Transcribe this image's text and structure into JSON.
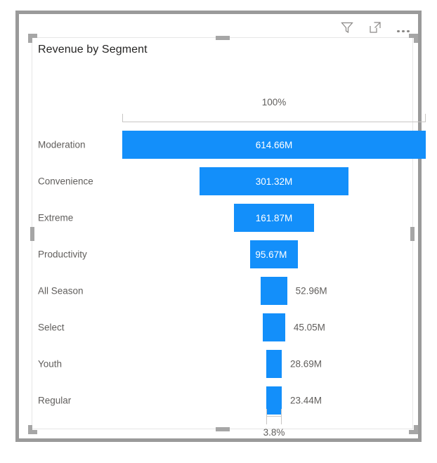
{
  "header": {
    "icons": [
      {
        "name": "filter-icon",
        "label": "Filters"
      },
      {
        "name": "focus-mode-icon",
        "label": "Focus mode"
      },
      {
        "name": "more-options-icon",
        "label": "More options"
      }
    ]
  },
  "visual": {
    "title": "Revenue by Segment",
    "top_axis_label": "100%",
    "bottom_axis_label": "3.8%",
    "accent_color": "#138ffa",
    "label_color": "#605e5c",
    "title_color": "#252423"
  },
  "chart_data": {
    "type": "bar",
    "subtype": "funnel",
    "title": "Revenue by Segment",
    "xlabel": "",
    "ylabel": "",
    "categories": [
      "Moderation",
      "Convenience",
      "Extreme",
      "Productivity",
      "All Season",
      "Select",
      "Youth",
      "Regular"
    ],
    "values": [
      614.66,
      301.32,
      161.87,
      95.67,
      52.96,
      45.05,
      28.69,
      23.44
    ],
    "value_labels": [
      "614.66M",
      "301.32M",
      "161.87M",
      "95.67M",
      "52.96M",
      "45.05M",
      "28.69M",
      "23.44M"
    ],
    "units": "M",
    "first_to_last_percent": "3.8%",
    "highest_percent": "100%",
    "grid": false,
    "legend": "none",
    "rows": [
      {
        "category": "Moderation",
        "value": 614.66,
        "value_label": "614.66M",
        "label_placement": "inside",
        "label_align": "center",
        "pct": 100.0
      },
      {
        "category": "Convenience",
        "value": 301.32,
        "value_label": "301.32M",
        "label_placement": "inside",
        "label_align": "center",
        "pct": 49.0
      },
      {
        "category": "Extreme",
        "value": 161.87,
        "value_label": "161.87M",
        "label_placement": "inside",
        "label_align": "center",
        "pct": 26.3
      },
      {
        "category": "Productivity",
        "value": 95.67,
        "value_label": "95.67M",
        "label_placement": "inside",
        "label_align": "left",
        "pct": 15.6
      },
      {
        "category": "All Season",
        "value": 52.96,
        "value_label": "52.96M",
        "label_placement": "outside",
        "label_align": "left",
        "pct": 8.6
      },
      {
        "category": "Select",
        "value": 45.05,
        "value_label": "45.05M",
        "label_placement": "outside",
        "label_align": "left",
        "pct": 7.3
      },
      {
        "category": "Youth",
        "value": 28.69,
        "value_label": "28.69M",
        "label_placement": "outside",
        "label_align": "left",
        "pct": 4.7
      },
      {
        "category": "Regular",
        "value": 23.44,
        "value_label": "23.44M",
        "label_placement": "outside",
        "label_align": "left",
        "pct": 3.8
      }
    ]
  }
}
